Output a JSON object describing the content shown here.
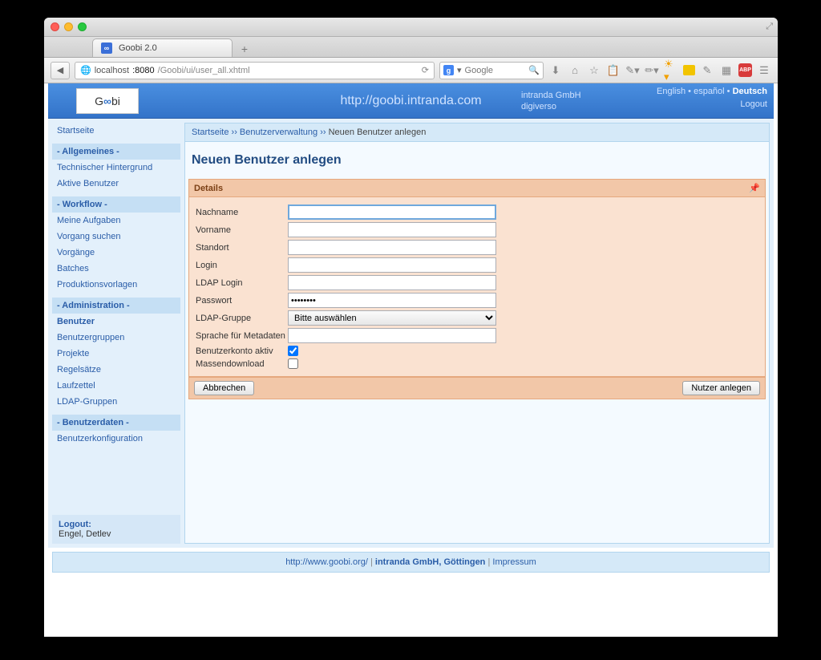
{
  "browser": {
    "tab_title": "Goobi 2.0",
    "url_host_prefix": "localhost",
    "url_host_port": ":8080",
    "url_path": "/Goobi/ui/user_all.xhtml",
    "search_placeholder": "Google"
  },
  "header": {
    "center_url": "http://goobi.intranda.com",
    "company": "intranda GmbH",
    "sub": "digiverso",
    "lang1": "English",
    "lang2": "español",
    "lang3": "Deutsch",
    "logout": "Logout"
  },
  "sidebar": {
    "home": "Startseite",
    "g1": "- Allgemeines -",
    "g1_1": "Technischer Hintergrund",
    "g1_2": "Aktive Benutzer",
    "g2": "- Workflow -",
    "g2_1": "Meine Aufgaben",
    "g2_2": "Vorgang suchen",
    "g2_3": "Vorgänge",
    "g2_4": "Batches",
    "g2_5": "Produktionsvorlagen",
    "g3": "- Administration -",
    "g3_1": "Benutzer",
    "g3_2": "Benutzergruppen",
    "g3_3": "Projekte",
    "g3_4": "Regelsätze",
    "g3_5": "Laufzettel",
    "g3_6": "LDAP-Gruppen",
    "g4": "- Benutzerdaten -",
    "g4_1": "Benutzerkonfiguration",
    "logout_label": "Logout:",
    "logout_user": "Engel, Detlev"
  },
  "crumb": {
    "c1": "Startseite",
    "c2": "Benutzerverwaltung",
    "c3": "Neuen Benutzer anlegen",
    "sep": " ›› "
  },
  "page_title": "Neuen Benutzer anlegen",
  "panel": {
    "title": "Details",
    "f_nachname": "Nachname",
    "f_vorname": "Vorname",
    "f_standort": "Standort",
    "f_login": "Login",
    "f_ldaplogin": "LDAP Login",
    "f_passwort": "Passwort",
    "v_passwort": "••••••••",
    "f_ldapgruppe": "LDAP-Gruppe",
    "v_ldapgruppe": "Bitte auswählen",
    "f_sprache": "Sprache für Metadaten",
    "f_aktiv": "Benutzerkonto aktiv",
    "f_massen": "Massendownload",
    "btn_cancel": "Abbrechen",
    "btn_save": "Nutzer anlegen"
  },
  "footer": {
    "url": "http://www.goobi.org/",
    "company": "intranda GmbH, Göttingen",
    "impressum": "Impressum"
  }
}
